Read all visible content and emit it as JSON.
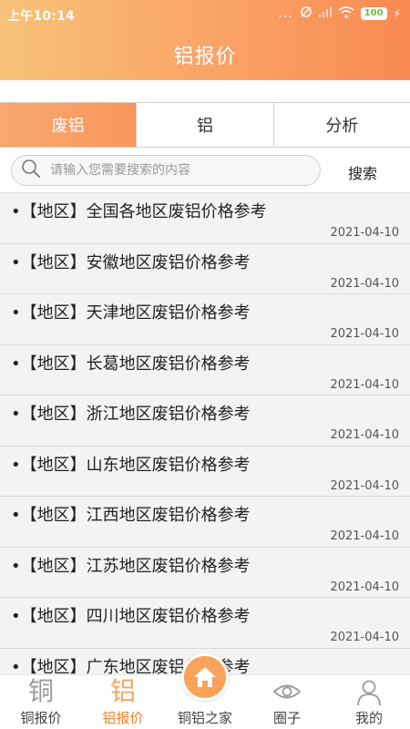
{
  "status_bar": {
    "time": "上午10:14",
    "dots": "...",
    "battery": "100"
  },
  "header": {
    "title": "铝报价"
  },
  "tabs": [
    {
      "label": "废铝",
      "active": true
    },
    {
      "label": "铝",
      "active": false
    },
    {
      "label": "分析",
      "active": false
    }
  ],
  "search": {
    "placeholder": "请输入您需要搜索的内容",
    "value": "",
    "button_label": "搜索"
  },
  "list": [
    {
      "title": "•【地区】全国各地区废铝价格参考",
      "date": "2021-04-10"
    },
    {
      "title": "•【地区】安徽地区废铝价格参考",
      "date": "2021-04-10"
    },
    {
      "title": "•【地区】天津地区废铝价格参考",
      "date": "2021-04-10"
    },
    {
      "title": "•【地区】长葛地区废铝价格参考",
      "date": "2021-04-10"
    },
    {
      "title": "•【地区】浙江地区废铝价格参考",
      "date": "2021-04-10"
    },
    {
      "title": "•【地区】山东地区废铝价格参考",
      "date": "2021-04-10"
    },
    {
      "title": "•【地区】江西地区废铝价格参考",
      "date": "2021-04-10"
    },
    {
      "title": "•【地区】江苏地区废铝价格参考",
      "date": "2021-04-10"
    },
    {
      "title": "•【地区】四川地区废铝价格参考",
      "date": "2021-04-10"
    },
    {
      "title": "•【地区】广东地区废铝价格参考",
      "date": ""
    }
  ],
  "bottom_nav": [
    {
      "label": "铜报价",
      "icon_glyph": "铜",
      "active": false
    },
    {
      "label": "铝报价",
      "icon_glyph": "铝",
      "active": true
    },
    {
      "label": "铜铝之家",
      "icon": "home-icon",
      "active": false
    },
    {
      "label": "圈子",
      "icon": "eye-icon",
      "active": false
    },
    {
      "label": "我的",
      "icon": "user-icon",
      "active": false
    }
  ],
  "colors": {
    "accent": "#f9955c",
    "header_gradient_start": "#f8c27a",
    "header_gradient_end": "#f98a52",
    "active_nav_label": "#f0822f"
  }
}
